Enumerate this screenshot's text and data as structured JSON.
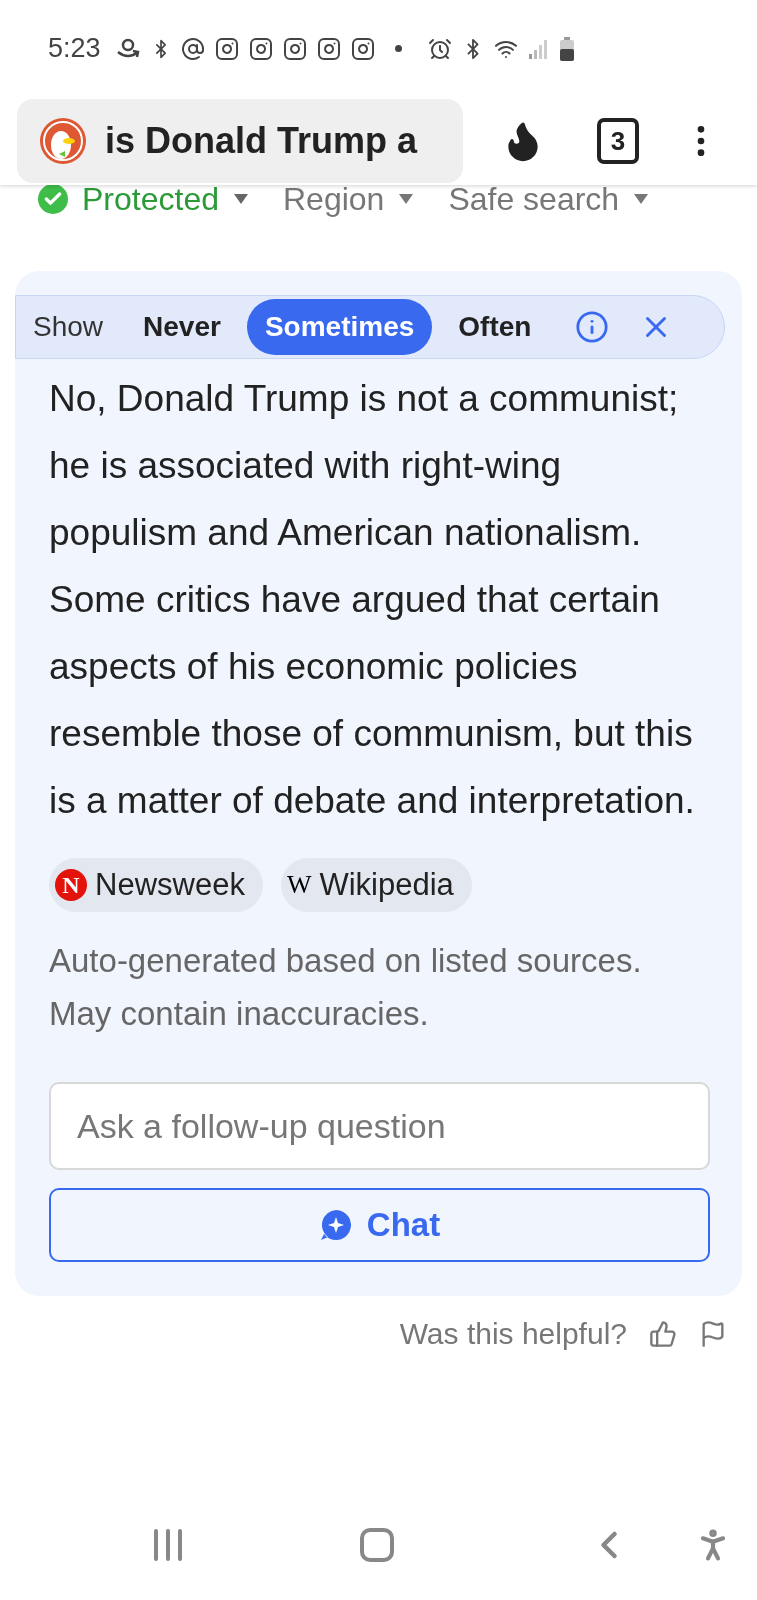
{
  "status_bar": {
    "time": "5:23"
  },
  "toolbar": {
    "query": "is Donald Trump a",
    "tab_count": "3"
  },
  "filters": [
    {
      "kind": "status",
      "label": "Protected"
    },
    {
      "kind": "dropdown",
      "label": "Region"
    },
    {
      "kind": "dropdown",
      "label": "Safe search"
    }
  ],
  "show_bar": {
    "label": "Show",
    "options": [
      {
        "label": "Never",
        "selected": false
      },
      {
        "label": "Sometimes",
        "selected": true
      },
      {
        "label": "Often",
        "selected": false
      }
    ]
  },
  "answer": "No, Donald Trump is not a communist; he is associated with right-wing populism and American nationalism. Some critics have argued that certain aspects of his economic policies resemble those of communism, but this is a matter of debate and interpretation.",
  "sources": [
    {
      "kind": "newsweek",
      "icon": "N",
      "name": "Newsweek"
    },
    {
      "kind": "wikipedia",
      "icon": "W",
      "name": "Wikipedia"
    }
  ],
  "disclaimer": "Auto-generated based on listed sources. May contain inaccuracies.",
  "followup": {
    "placeholder": "Ask a follow-up question"
  },
  "chat_button": "Chat",
  "feedback": "Was this helpful?"
}
